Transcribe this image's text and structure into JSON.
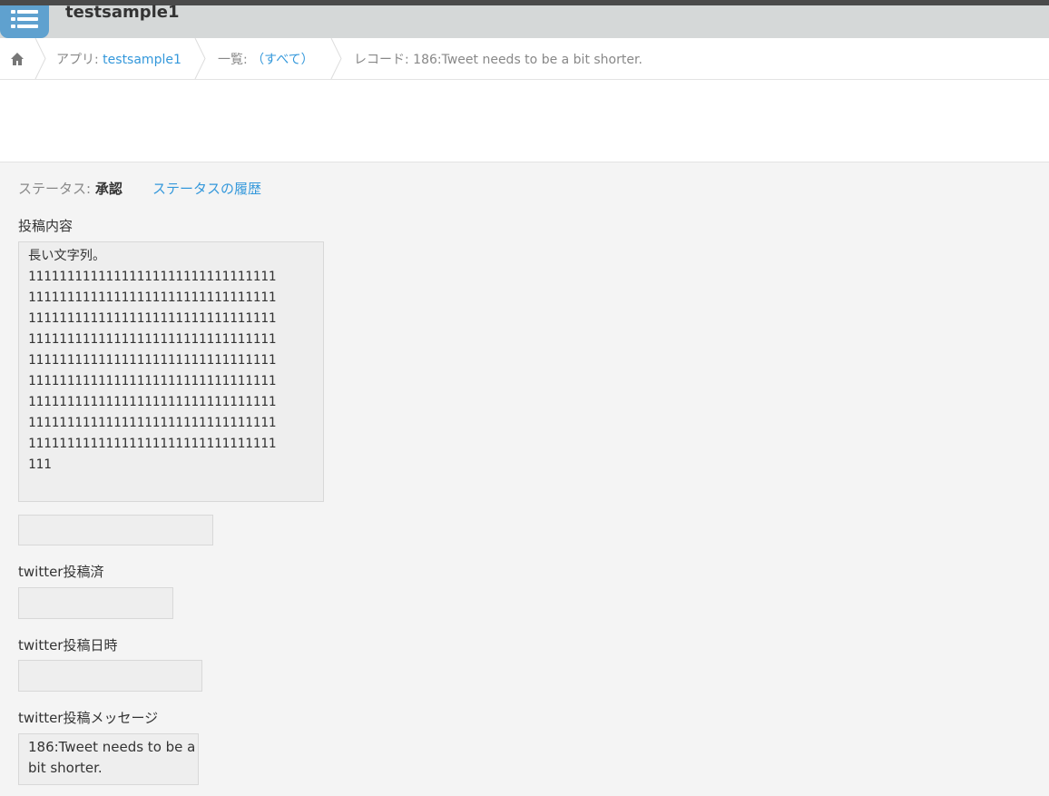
{
  "app": {
    "title": "testsample1"
  },
  "breadcrumb": {
    "app_prefix": "アプリ: ",
    "app_name": "testsample1",
    "list_prefix": "一覧: ",
    "list_name": "（すべて）",
    "record": "レコード: 186:Tweet needs to be a bit shorter."
  },
  "status": {
    "label": "ステータス: ",
    "value": "承認",
    "history_link": "ステータスの履歴"
  },
  "fields": {
    "content_label": "投稿内容",
    "content_value": "長い文字列。\n11111111111111111111111111111111\n11111111111111111111111111111111\n11111111111111111111111111111111\n11111111111111111111111111111111\n11111111111111111111111111111111\n11111111111111111111111111111111\n11111111111111111111111111111111\n11111111111111111111111111111111\n11111111111111111111111111111111\n111",
    "blank_value": "",
    "posted_label": "twitter投稿済",
    "posted_value": "",
    "posted_at_label": "twitter投稿日時",
    "posted_at_value": "",
    "message_label": "twitter投稿メッセージ",
    "message_value": "186:Tweet needs to be a bit shorter."
  },
  "icons": {
    "app": "list-icon",
    "home": "home-icon",
    "separator": "chevron-right-icon"
  },
  "colors": {
    "link": "#3498db",
    "app_icon": "#5fa1cf",
    "header_bg": "#d5d8d8",
    "page_bg": "#f4f4f4"
  }
}
